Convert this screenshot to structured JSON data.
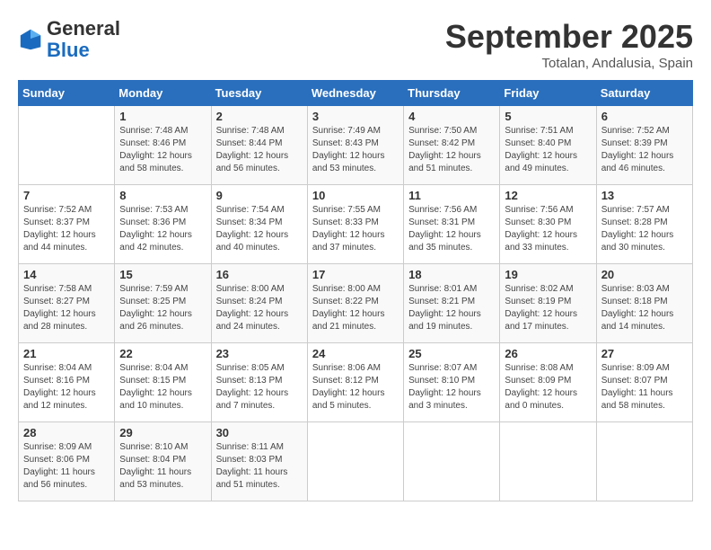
{
  "header": {
    "logo_general": "General",
    "logo_blue": "Blue",
    "month": "September 2025",
    "location": "Totalan, Andalusia, Spain"
  },
  "columns": [
    "Sunday",
    "Monday",
    "Tuesday",
    "Wednesday",
    "Thursday",
    "Friday",
    "Saturday"
  ],
  "weeks": [
    [
      {
        "day": "",
        "info": ""
      },
      {
        "day": "1",
        "info": "Sunrise: 7:48 AM\nSunset: 8:46 PM\nDaylight: 12 hours\nand 58 minutes."
      },
      {
        "day": "2",
        "info": "Sunrise: 7:48 AM\nSunset: 8:44 PM\nDaylight: 12 hours\nand 56 minutes."
      },
      {
        "day": "3",
        "info": "Sunrise: 7:49 AM\nSunset: 8:43 PM\nDaylight: 12 hours\nand 53 minutes."
      },
      {
        "day": "4",
        "info": "Sunrise: 7:50 AM\nSunset: 8:42 PM\nDaylight: 12 hours\nand 51 minutes."
      },
      {
        "day": "5",
        "info": "Sunrise: 7:51 AM\nSunset: 8:40 PM\nDaylight: 12 hours\nand 49 minutes."
      },
      {
        "day": "6",
        "info": "Sunrise: 7:52 AM\nSunset: 8:39 PM\nDaylight: 12 hours\nand 46 minutes."
      }
    ],
    [
      {
        "day": "7",
        "info": "Sunrise: 7:52 AM\nSunset: 8:37 PM\nDaylight: 12 hours\nand 44 minutes."
      },
      {
        "day": "8",
        "info": "Sunrise: 7:53 AM\nSunset: 8:36 PM\nDaylight: 12 hours\nand 42 minutes."
      },
      {
        "day": "9",
        "info": "Sunrise: 7:54 AM\nSunset: 8:34 PM\nDaylight: 12 hours\nand 40 minutes."
      },
      {
        "day": "10",
        "info": "Sunrise: 7:55 AM\nSunset: 8:33 PM\nDaylight: 12 hours\nand 37 minutes."
      },
      {
        "day": "11",
        "info": "Sunrise: 7:56 AM\nSunset: 8:31 PM\nDaylight: 12 hours\nand 35 minutes."
      },
      {
        "day": "12",
        "info": "Sunrise: 7:56 AM\nSunset: 8:30 PM\nDaylight: 12 hours\nand 33 minutes."
      },
      {
        "day": "13",
        "info": "Sunrise: 7:57 AM\nSunset: 8:28 PM\nDaylight: 12 hours\nand 30 minutes."
      }
    ],
    [
      {
        "day": "14",
        "info": "Sunrise: 7:58 AM\nSunset: 8:27 PM\nDaylight: 12 hours\nand 28 minutes."
      },
      {
        "day": "15",
        "info": "Sunrise: 7:59 AM\nSunset: 8:25 PM\nDaylight: 12 hours\nand 26 minutes."
      },
      {
        "day": "16",
        "info": "Sunrise: 8:00 AM\nSunset: 8:24 PM\nDaylight: 12 hours\nand 24 minutes."
      },
      {
        "day": "17",
        "info": "Sunrise: 8:00 AM\nSunset: 8:22 PM\nDaylight: 12 hours\nand 21 minutes."
      },
      {
        "day": "18",
        "info": "Sunrise: 8:01 AM\nSunset: 8:21 PM\nDaylight: 12 hours\nand 19 minutes."
      },
      {
        "day": "19",
        "info": "Sunrise: 8:02 AM\nSunset: 8:19 PM\nDaylight: 12 hours\nand 17 minutes."
      },
      {
        "day": "20",
        "info": "Sunrise: 8:03 AM\nSunset: 8:18 PM\nDaylight: 12 hours\nand 14 minutes."
      }
    ],
    [
      {
        "day": "21",
        "info": "Sunrise: 8:04 AM\nSunset: 8:16 PM\nDaylight: 12 hours\nand 12 minutes."
      },
      {
        "day": "22",
        "info": "Sunrise: 8:04 AM\nSunset: 8:15 PM\nDaylight: 12 hours\nand 10 minutes."
      },
      {
        "day": "23",
        "info": "Sunrise: 8:05 AM\nSunset: 8:13 PM\nDaylight: 12 hours\nand 7 minutes."
      },
      {
        "day": "24",
        "info": "Sunrise: 8:06 AM\nSunset: 8:12 PM\nDaylight: 12 hours\nand 5 minutes."
      },
      {
        "day": "25",
        "info": "Sunrise: 8:07 AM\nSunset: 8:10 PM\nDaylight: 12 hours\nand 3 minutes."
      },
      {
        "day": "26",
        "info": "Sunrise: 8:08 AM\nSunset: 8:09 PM\nDaylight: 12 hours\nand 0 minutes."
      },
      {
        "day": "27",
        "info": "Sunrise: 8:09 AM\nSunset: 8:07 PM\nDaylight: 11 hours\nand 58 minutes."
      }
    ],
    [
      {
        "day": "28",
        "info": "Sunrise: 8:09 AM\nSunset: 8:06 PM\nDaylight: 11 hours\nand 56 minutes."
      },
      {
        "day": "29",
        "info": "Sunrise: 8:10 AM\nSunset: 8:04 PM\nDaylight: 11 hours\nand 53 minutes."
      },
      {
        "day": "30",
        "info": "Sunrise: 8:11 AM\nSunset: 8:03 PM\nDaylight: 11 hours\nand 51 minutes."
      },
      {
        "day": "",
        "info": ""
      },
      {
        "day": "",
        "info": ""
      },
      {
        "day": "",
        "info": ""
      },
      {
        "day": "",
        "info": ""
      }
    ]
  ]
}
